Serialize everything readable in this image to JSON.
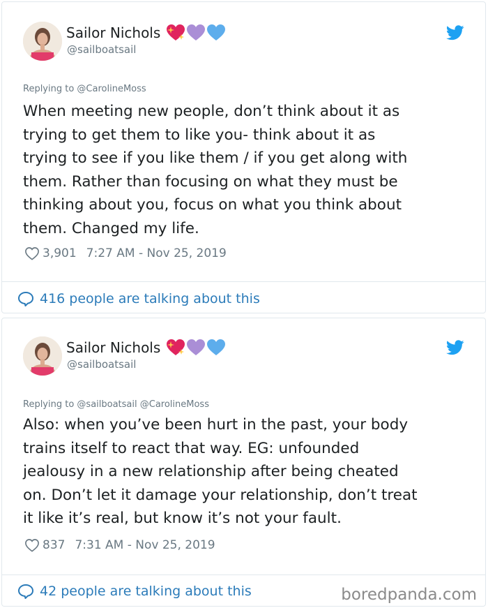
{
  "tweets": [
    {
      "author_name": "Sailor Nichols",
      "author_handle": "@sailboatsail",
      "name_emojis": [
        "sparkling-heart",
        "purple-heart",
        "blue-heart"
      ],
      "replying_to": "Replying to @CarolineMoss",
      "text": "When meeting new people, don’t think about it as\ntrying to get them to like you- think about it as\ntrying to see if you like them / if you get along with\nthem. Rather than focusing on what they must be\nthinking about you, focus on what you think about\nthem. Changed my life.",
      "likes": "3,901",
      "timestamp": "7:27 AM - Nov 25, 2019",
      "talking": "416 people are talking about this"
    },
    {
      "author_name": "Sailor Nichols",
      "author_handle": "@sailboatsail",
      "name_emojis": [
        "sparkling-heart",
        "purple-heart",
        "blue-heart"
      ],
      "replying_to": "Replying to @sailboatsail @CarolineMoss",
      "text": "Also: when you’ve been hurt in the past, your body\ntrains itself to react that way. EG: unfounded\njealousy in a new relationship after being cheated\non. Don’t let it damage your relationship, don’t treat\nit like it’s real, but know it’s not your fault.",
      "likes": "837",
      "timestamp": "7:31 AM - Nov 25, 2019",
      "talking": "42 people are talking about this"
    }
  ],
  "watermark": "boredpanda.com",
  "icons": {
    "twitter": "twitter-bird-icon",
    "like": "heart-outline-icon",
    "reply": "speech-bubble-icon"
  },
  "colors": {
    "twitter_blue": "#1da1f2",
    "link_blue": "#2b7bb9",
    "muted_text": "#697882",
    "border": "#e1e8ed",
    "sparkling_heart": "#e0245e",
    "purple_heart": "#aa8ed6",
    "blue_heart": "#5dadec"
  }
}
